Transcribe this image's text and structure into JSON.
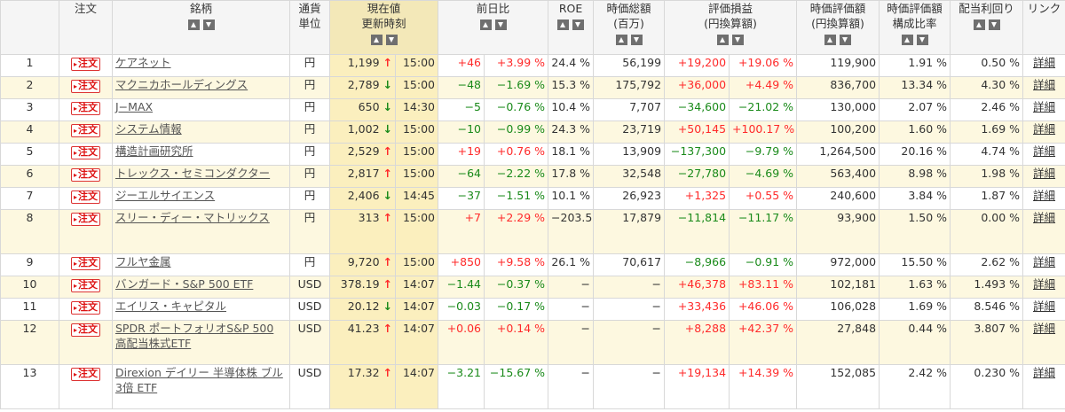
{
  "headers": {
    "idx": "",
    "order": "注文",
    "name": "銘柄",
    "currency": "通貨\n単位",
    "price": "現在値\n更新時刻",
    "change": "前日比",
    "roe": "ROE",
    "mcap": "時価総額\n(百万)",
    "pl": "評価損益\n(円換算額)",
    "value": "時価評価額\n(円換算額)",
    "ratio": "時価評価額\n構成比率",
    "yield": "配当利回り",
    "link": "リンク"
  },
  "order_label": "注文",
  "detail_label": "詳細",
  "rows": [
    {
      "no": "1",
      "name": "ケアネット",
      "cur": "円",
      "price": "1,199",
      "dir": "up",
      "time": "15:00",
      "chg": "+46",
      "chgp": "+3.99 %",
      "roe": "24.4 %",
      "mcap": "56,199",
      "pl": "+19,200",
      "plp": "+19.06 %",
      "val": "119,900",
      "ratio": "1.91 %",
      "yld": "0.50 %"
    },
    {
      "no": "2",
      "name": "マクニカホールディングス",
      "cur": "円",
      "price": "2,789",
      "dir": "down",
      "time": "15:00",
      "chg": "−48",
      "chgp": "−1.69 %",
      "roe": "15.3 %",
      "mcap": "175,792",
      "pl": "+36,000",
      "plp": "+4.49 %",
      "val": "836,700",
      "ratio": "13.34 %",
      "yld": "4.30 %"
    },
    {
      "no": "3",
      "name": "J−MAX",
      "cur": "円",
      "price": "650",
      "dir": "down",
      "time": "14:30",
      "chg": "−5",
      "chgp": "−0.76 %",
      "roe": "10.4 %",
      "mcap": "7,707",
      "pl": "−34,600",
      "plp": "−21.02 %",
      "val": "130,000",
      "ratio": "2.07 %",
      "yld": "2.46 %"
    },
    {
      "no": "4",
      "name": "システム情報",
      "cur": "円",
      "price": "1,002",
      "dir": "down",
      "time": "15:00",
      "chg": "−10",
      "chgp": "−0.99 %",
      "roe": "24.3 %",
      "mcap": "23,719",
      "pl": "+50,145",
      "plp": "+100.17 %",
      "val": "100,200",
      "ratio": "1.60 %",
      "yld": "1.69 %"
    },
    {
      "no": "5",
      "name": "構造計画研究所",
      "cur": "円",
      "price": "2,529",
      "dir": "up",
      "time": "15:00",
      "chg": "+19",
      "chgp": "+0.76 %",
      "roe": "18.1 %",
      "mcap": "13,909",
      "pl": "−137,300",
      "plp": "−9.79 %",
      "val": "1,264,500",
      "ratio": "20.16 %",
      "yld": "4.74 %"
    },
    {
      "no": "6",
      "name": "トレックス・セミコンダクター",
      "cur": "円",
      "price": "2,817",
      "dir": "up",
      "time": "15:00",
      "chg": "−64",
      "chgp": "−2.22 %",
      "roe": "17.8 %",
      "mcap": "32,548",
      "pl": "−27,780",
      "plp": "−4.69 %",
      "val": "563,400",
      "ratio": "8.98 %",
      "yld": "1.98 %"
    },
    {
      "no": "7",
      "name": "ジーエルサイエンス",
      "cur": "円",
      "price": "2,406",
      "dir": "down",
      "time": "14:45",
      "chg": "−37",
      "chgp": "−1.51 %",
      "roe": "10.1 %",
      "mcap": "26,923",
      "pl": "+1,325",
      "plp": "+0.55 %",
      "val": "240,600",
      "ratio": "3.84 %",
      "yld": "1.87 %"
    },
    {
      "no": "8",
      "name": "スリー・ディー・マトリックス",
      "cur": "円",
      "price": "313",
      "dir": "up",
      "time": "15:00",
      "chg": "+7",
      "chgp": "+2.29 %",
      "roe": "−203.5 %",
      "mcap": "17,879",
      "pl": "−11,814",
      "plp": "−11.17 %",
      "val": "93,900",
      "ratio": "1.50 %",
      "yld": "0.00 %"
    },
    {
      "no": "9",
      "name": "フルヤ金属",
      "cur": "円",
      "price": "9,720",
      "dir": "up",
      "time": "15:00",
      "chg": "+850",
      "chgp": "+9.58 %",
      "roe": "26.1 %",
      "mcap": "70,617",
      "pl": "−8,966",
      "plp": "−0.91 %",
      "val": "972,000",
      "ratio": "15.50 %",
      "yld": "2.62 %"
    },
    {
      "no": "10",
      "name": "バンガード・S&P 500 ETF",
      "cur": "USD",
      "price": "378.19",
      "dir": "up",
      "time": "14:07",
      "chg": "−1.44",
      "chgp": "−0.37 %",
      "roe": "−",
      "mcap": "−",
      "pl": "+46,378",
      "plp": "+83.11 %",
      "val": "102,181",
      "ratio": "1.63 %",
      "yld": "1.493 %"
    },
    {
      "no": "11",
      "name": "エイリス・キャピタル",
      "cur": "USD",
      "price": "20.12",
      "dir": "down",
      "time": "14:07",
      "chg": "−0.03",
      "chgp": "−0.17 %",
      "roe": "−",
      "mcap": "−",
      "pl": "+33,436",
      "plp": "+46.06 %",
      "val": "106,028",
      "ratio": "1.69 %",
      "yld": "8.546 %"
    },
    {
      "no": "12",
      "name": "SPDR ポートフォリオS&P 500 高配当株式ETF",
      "cur": "USD",
      "price": "41.23",
      "dir": "up",
      "time": "14:07",
      "chg": "+0.06",
      "chgp": "+0.14 %",
      "roe": "−",
      "mcap": "−",
      "pl": "+8,288",
      "plp": "+42.37 %",
      "val": "27,848",
      "ratio": "0.44 %",
      "yld": "3.807 %"
    },
    {
      "no": "13",
      "name": "Direxion デイリー 半導体株 ブル 3倍 ETF",
      "cur": "USD",
      "price": "17.32",
      "dir": "up",
      "time": "14:07",
      "chg": "−3.21",
      "chgp": "−15.67 %",
      "roe": "−",
      "mcap": "−",
      "pl": "+19,134",
      "plp": "+14.39 %",
      "val": "152,085",
      "ratio": "2.42 %",
      "yld": "0.230 %"
    }
  ],
  "colors": {
    "positive": "#ff2a2a",
    "negative": "#1a8a1a",
    "price_highlight": "#fbefbe",
    "row_alt": "#fdf8e0"
  }
}
